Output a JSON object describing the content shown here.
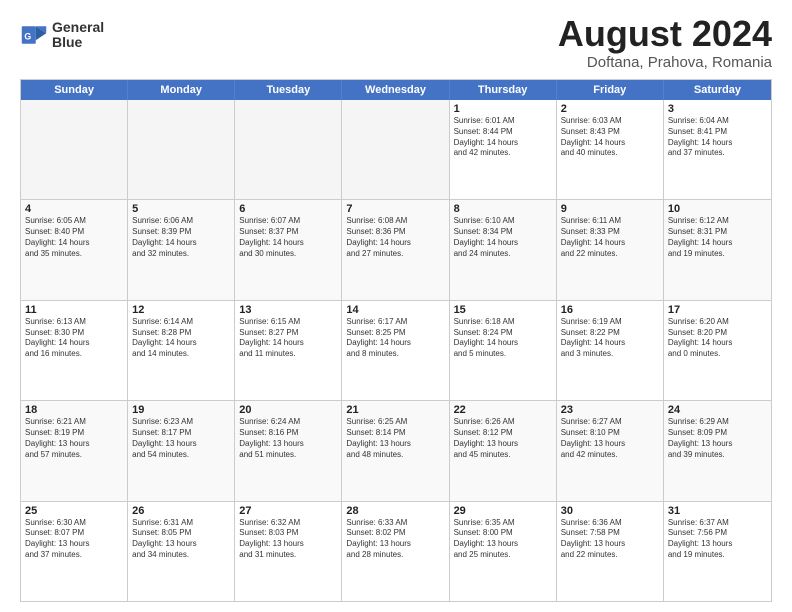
{
  "header": {
    "logo_line1": "General",
    "logo_line2": "Blue",
    "month_title": "August 2024",
    "location": "Doftana, Prahova, Romania"
  },
  "days_of_week": [
    "Sunday",
    "Monday",
    "Tuesday",
    "Wednesday",
    "Thursday",
    "Friday",
    "Saturday"
  ],
  "weeks": [
    [
      {
        "day": "",
        "empty": true
      },
      {
        "day": "",
        "empty": true
      },
      {
        "day": "",
        "empty": true
      },
      {
        "day": "",
        "empty": true
      },
      {
        "day": "1",
        "info": "Sunrise: 6:01 AM\nSunset: 8:44 PM\nDaylight: 14 hours\nand 42 minutes."
      },
      {
        "day": "2",
        "info": "Sunrise: 6:03 AM\nSunset: 8:43 PM\nDaylight: 14 hours\nand 40 minutes."
      },
      {
        "day": "3",
        "info": "Sunrise: 6:04 AM\nSunset: 8:41 PM\nDaylight: 14 hours\nand 37 minutes."
      }
    ],
    [
      {
        "day": "4",
        "info": "Sunrise: 6:05 AM\nSunset: 8:40 PM\nDaylight: 14 hours\nand 35 minutes."
      },
      {
        "day": "5",
        "info": "Sunrise: 6:06 AM\nSunset: 8:39 PM\nDaylight: 14 hours\nand 32 minutes."
      },
      {
        "day": "6",
        "info": "Sunrise: 6:07 AM\nSunset: 8:37 PM\nDaylight: 14 hours\nand 30 minutes."
      },
      {
        "day": "7",
        "info": "Sunrise: 6:08 AM\nSunset: 8:36 PM\nDaylight: 14 hours\nand 27 minutes."
      },
      {
        "day": "8",
        "info": "Sunrise: 6:10 AM\nSunset: 8:34 PM\nDaylight: 14 hours\nand 24 minutes."
      },
      {
        "day": "9",
        "info": "Sunrise: 6:11 AM\nSunset: 8:33 PM\nDaylight: 14 hours\nand 22 minutes."
      },
      {
        "day": "10",
        "info": "Sunrise: 6:12 AM\nSunset: 8:31 PM\nDaylight: 14 hours\nand 19 minutes."
      }
    ],
    [
      {
        "day": "11",
        "info": "Sunrise: 6:13 AM\nSunset: 8:30 PM\nDaylight: 14 hours\nand 16 minutes."
      },
      {
        "day": "12",
        "info": "Sunrise: 6:14 AM\nSunset: 8:28 PM\nDaylight: 14 hours\nand 14 minutes."
      },
      {
        "day": "13",
        "info": "Sunrise: 6:15 AM\nSunset: 8:27 PM\nDaylight: 14 hours\nand 11 minutes."
      },
      {
        "day": "14",
        "info": "Sunrise: 6:17 AM\nSunset: 8:25 PM\nDaylight: 14 hours\nand 8 minutes."
      },
      {
        "day": "15",
        "info": "Sunrise: 6:18 AM\nSunset: 8:24 PM\nDaylight: 14 hours\nand 5 minutes."
      },
      {
        "day": "16",
        "info": "Sunrise: 6:19 AM\nSunset: 8:22 PM\nDaylight: 14 hours\nand 3 minutes."
      },
      {
        "day": "17",
        "info": "Sunrise: 6:20 AM\nSunset: 8:20 PM\nDaylight: 14 hours\nand 0 minutes."
      }
    ],
    [
      {
        "day": "18",
        "info": "Sunrise: 6:21 AM\nSunset: 8:19 PM\nDaylight: 13 hours\nand 57 minutes."
      },
      {
        "day": "19",
        "info": "Sunrise: 6:23 AM\nSunset: 8:17 PM\nDaylight: 13 hours\nand 54 minutes."
      },
      {
        "day": "20",
        "info": "Sunrise: 6:24 AM\nSunset: 8:16 PM\nDaylight: 13 hours\nand 51 minutes."
      },
      {
        "day": "21",
        "info": "Sunrise: 6:25 AM\nSunset: 8:14 PM\nDaylight: 13 hours\nand 48 minutes."
      },
      {
        "day": "22",
        "info": "Sunrise: 6:26 AM\nSunset: 8:12 PM\nDaylight: 13 hours\nand 45 minutes."
      },
      {
        "day": "23",
        "info": "Sunrise: 6:27 AM\nSunset: 8:10 PM\nDaylight: 13 hours\nand 42 minutes."
      },
      {
        "day": "24",
        "info": "Sunrise: 6:29 AM\nSunset: 8:09 PM\nDaylight: 13 hours\nand 39 minutes."
      }
    ],
    [
      {
        "day": "25",
        "info": "Sunrise: 6:30 AM\nSunset: 8:07 PM\nDaylight: 13 hours\nand 37 minutes."
      },
      {
        "day": "26",
        "info": "Sunrise: 6:31 AM\nSunset: 8:05 PM\nDaylight: 13 hours\nand 34 minutes."
      },
      {
        "day": "27",
        "info": "Sunrise: 6:32 AM\nSunset: 8:03 PM\nDaylight: 13 hours\nand 31 minutes."
      },
      {
        "day": "28",
        "info": "Sunrise: 6:33 AM\nSunset: 8:02 PM\nDaylight: 13 hours\nand 28 minutes."
      },
      {
        "day": "29",
        "info": "Sunrise: 6:35 AM\nSunset: 8:00 PM\nDaylight: 13 hours\nand 25 minutes."
      },
      {
        "day": "30",
        "info": "Sunrise: 6:36 AM\nSunset: 7:58 PM\nDaylight: 13 hours\nand 22 minutes."
      },
      {
        "day": "31",
        "info": "Sunrise: 6:37 AM\nSunset: 7:56 PM\nDaylight: 13 hours\nand 19 minutes."
      }
    ]
  ]
}
